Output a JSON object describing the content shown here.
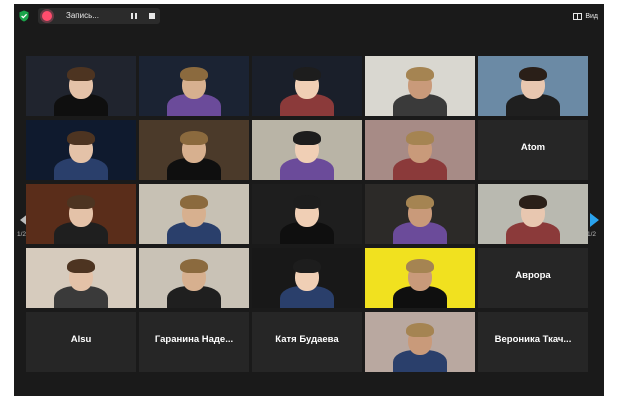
{
  "app": {
    "recording": {
      "label": "Запись...",
      "icon": "record-icon"
    },
    "view_button": {
      "label": "Вид",
      "icon": "grid-view-icon"
    },
    "security_icon": "shield-check-icon",
    "pagination": {
      "current": "1/2",
      "left": "1/2",
      "right": "1/2"
    }
  },
  "participants": [
    {
      "type": "video",
      "name": "",
      "tone": "#20242e",
      "active": true
    },
    {
      "type": "video",
      "name": "",
      "tone": "#1b2333"
    },
    {
      "type": "video",
      "name": "",
      "tone": "#1a1f2a"
    },
    {
      "type": "video",
      "name": "",
      "tone": "#d9d7d0"
    },
    {
      "type": "video",
      "name": "",
      "tone": "#6b8aa5"
    },
    {
      "type": "video",
      "name": "",
      "tone": "#0f1a2e"
    },
    {
      "type": "video",
      "name": "",
      "tone": "#4b3a2a"
    },
    {
      "type": "video",
      "name": "",
      "tone": "#b9b4a6"
    },
    {
      "type": "video",
      "name": "",
      "tone": "#a78b86"
    },
    {
      "type": "name",
      "name": "Atom"
    },
    {
      "type": "video",
      "name": "",
      "tone": "#5a2d1a"
    },
    {
      "type": "video",
      "name": "",
      "tone": "#c7c1b4"
    },
    {
      "type": "video",
      "name": "",
      "tone": "#1e1e1e"
    },
    {
      "type": "video",
      "name": "",
      "tone": "#2c2a28"
    },
    {
      "type": "video",
      "name": "",
      "tone": "#b9b9b0"
    },
    {
      "type": "video",
      "name": "",
      "tone": "#d6cbbd"
    },
    {
      "type": "video",
      "name": "",
      "tone": "#c9c2b6"
    },
    {
      "type": "video",
      "name": "",
      "tone": "#181818"
    },
    {
      "type": "video",
      "name": "",
      "tone": "#f1e11f"
    },
    {
      "type": "name",
      "name": "Аврора"
    },
    {
      "type": "name",
      "name": "Alsu"
    },
    {
      "type": "name",
      "name": "Гаранина  Наде..."
    },
    {
      "type": "name",
      "name": "Катя Будаева"
    },
    {
      "type": "video",
      "name": "",
      "tone": "#b9a8a0"
    },
    {
      "type": "name",
      "name": "Вероника  Ткач..."
    }
  ]
}
